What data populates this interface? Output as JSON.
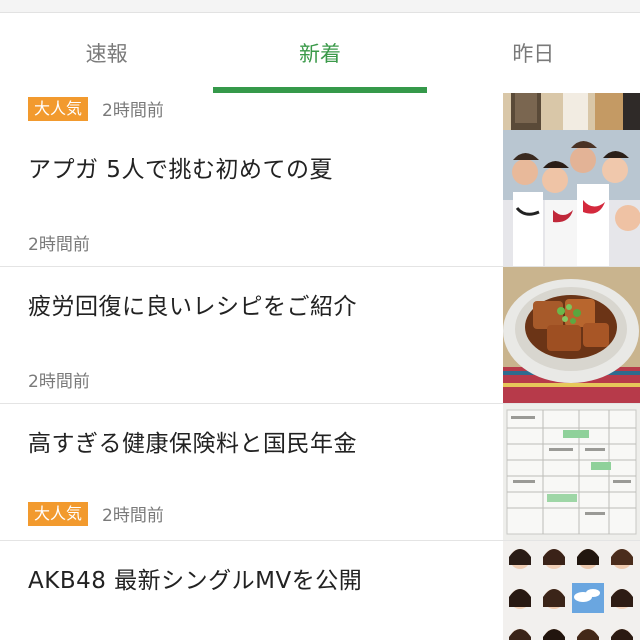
{
  "tabs": [
    {
      "label": "速報",
      "active": false
    },
    {
      "label": "新着",
      "active": true
    },
    {
      "label": "昨日",
      "active": false
    }
  ],
  "colors": {
    "accent_green": "#35994a",
    "badge_orange": "#f29a2e",
    "meta_gray": "#7a7a7a"
  },
  "feed": {
    "items": [
      {
        "title": "",
        "badge": "大人気",
        "time": "2時間前",
        "thumbnail": "fashion-photo"
      },
      {
        "title": "アプガ 5人で挑む初めての夏",
        "badge": "",
        "time": "2時間前",
        "thumbnail": "group-photo"
      },
      {
        "title": "疲労回復に良いレシピをご紹介",
        "badge": "",
        "time": "2時間前",
        "thumbnail": "food-photo"
      },
      {
        "title": "高すぎる健康保険料と国民年金",
        "badge": "大人気",
        "time": "2時間前",
        "thumbnail": "document-photo"
      },
      {
        "title": "AKB48 最新シングルMVを公開",
        "badge": "",
        "time": "",
        "thumbnail": "portrait-grid-photo"
      }
    ]
  }
}
